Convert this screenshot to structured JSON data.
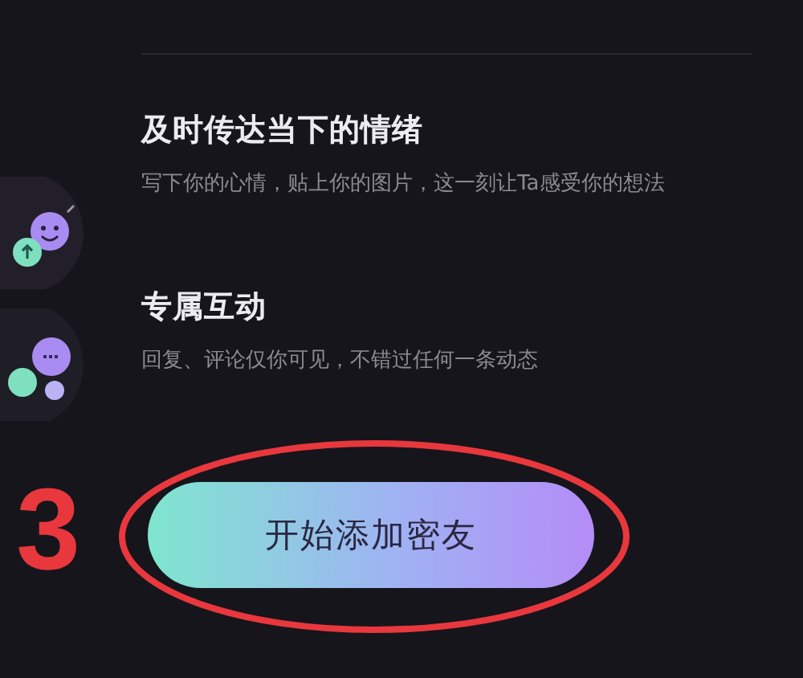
{
  "features": [
    {
      "kind": "emotion",
      "title": "及时传达当下的情绪",
      "description": "写下你的心情，贴上你的图片，这一刻让Ta感受你的想法"
    },
    {
      "kind": "interaction",
      "title": "专属互动",
      "description": "回复、评论仅你可见，不错过任何一条动态"
    }
  ],
  "button": {
    "label": "开始添加密友"
  },
  "annotation": {
    "step": "3"
  }
}
